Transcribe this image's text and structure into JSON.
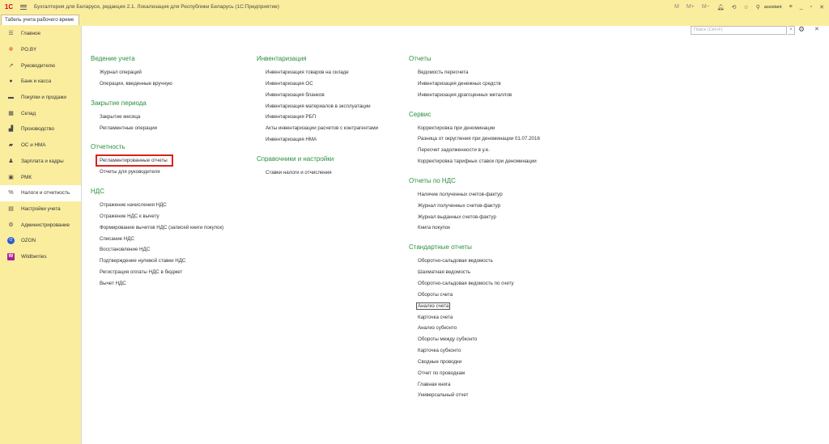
{
  "titlebar": {
    "logo": "1C",
    "title": "Бухгалтерия для Беларуси, редакция 2.1. Локализация для Республики Беларусь   (1С:Предприятие)",
    "tools": {
      "m": "M",
      "mplus": "M+",
      "mminus": "M−",
      "user": "assistant"
    }
  },
  "tabs": [
    {
      "label": "Табель учета рабочего време"
    }
  ],
  "sidebar": {
    "items": [
      {
        "label": "Главное",
        "icon": "menu-icon"
      },
      {
        "label": "PO.BY",
        "icon": "sun-icon"
      },
      {
        "label": "Руководителю",
        "icon": "chart-icon"
      },
      {
        "label": "Банк и касса",
        "icon": "coin-icon"
      },
      {
        "label": "Покупки и продажи",
        "icon": "cart-icon"
      },
      {
        "label": "Склад",
        "icon": "warehouse-icon"
      },
      {
        "label": "Производство",
        "icon": "factory-icon"
      },
      {
        "label": "ОС и НМА",
        "icon": "truck-icon"
      },
      {
        "label": "Зарплата и кадры",
        "icon": "person-icon"
      },
      {
        "label": "РМК",
        "icon": "register-icon"
      },
      {
        "label": "Налоги и отчетность",
        "icon": "percent-icon"
      },
      {
        "label": "Настройки учета",
        "icon": "book-icon"
      },
      {
        "label": "Администрирование",
        "icon": "gear-icon"
      },
      {
        "label": "OZON",
        "icon": "ozon-icon"
      },
      {
        "label": "Wildberries",
        "icon": "wildberries-icon"
      }
    ],
    "active_index": 10
  },
  "search": {
    "placeholder": "Поиск (Ctrl+F)"
  },
  "columns": [
    {
      "groups": [
        {
          "title": "Ведение учета",
          "items": [
            "Журнал операций",
            "Операции, введенные вручную"
          ]
        },
        {
          "title": "Закрытие периода",
          "items": [
            "Закрытие месяца",
            "Регламентные операции"
          ]
        },
        {
          "title": "Отчетность",
          "items": [
            "Регламентированные отчеты",
            "Отчеты для руководителя"
          ]
        },
        {
          "title": "НДС",
          "items": [
            "Отражение начисления НДС",
            "Отражение НДС к вычету",
            "Формирование вычетов НДС (записей книги покупок)",
            "Списание НДС",
            "Восстановление НДС",
            "Подтверждение нулевой ставки НДС",
            "Регистрация оплаты НДС в бюджет",
            "Вычет НДС"
          ]
        }
      ]
    },
    {
      "groups": [
        {
          "title": "Инвентаризация",
          "items": [
            "Инвентаризация товаров на складе",
            "Инвентаризация ОС",
            "Инвентаризация бланков",
            "Инвентаризация материалов в эксплуатации",
            "Инвентаризация РБП",
            "Акты инвентаризации расчетов с контрагентами",
            "Инвентаризация НМА"
          ]
        },
        {
          "title": "Справочники и настройки",
          "items": [
            "Ставки налоги и отчисления"
          ]
        }
      ]
    },
    {
      "groups": [
        {
          "title": "Отчеты",
          "items": [
            "Ведомость пересчета",
            "Инвентаризация денежных средств",
            "Инвентаризация драгоценных металлов"
          ]
        },
        {
          "title": "Сервис",
          "items": [
            "Корректировка при деноминации",
            "Разница от округления при деноминации 01.07.2016",
            "Пересчет задолженности в у.е.",
            "Корректировка тарифных ставок при деноминации"
          ]
        },
        {
          "title": "Отчеты по НДС",
          "items": [
            "Наличие полученных счетов-фактур",
            "Журнал полученных счетов-фактур",
            "Журнал выданных счетов-фактур",
            "Книга покупок"
          ]
        },
        {
          "title": "Стандартные отчеты",
          "items": [
            "Оборотно-сальдовая ведомость",
            "Шахматная ведомость",
            "Оборотно-сальдовая ведомость по счету",
            "Обороты счета",
            "Анализ счета",
            "Карточка счета",
            "Анализ субконто",
            "Обороты между субконто",
            "Карточка субконто",
            "Сводные проводки",
            "Отчет по проводкам",
            "Главная книга",
            "Универсальный отчет"
          ]
        }
      ]
    }
  ]
}
